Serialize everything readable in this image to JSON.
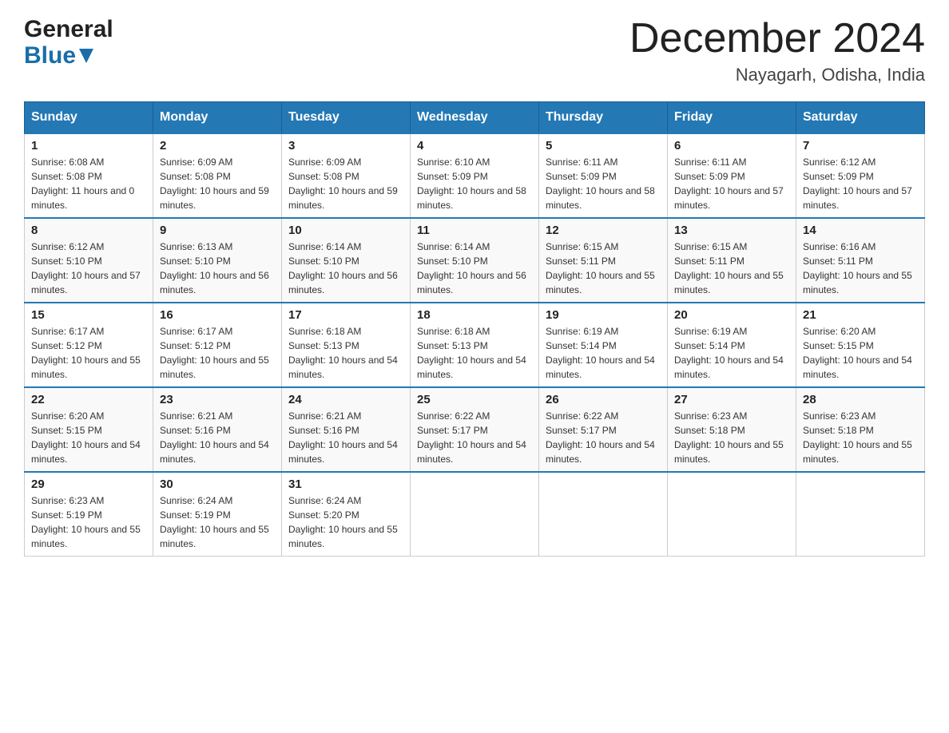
{
  "header": {
    "logo_general": "General",
    "logo_blue": "Blue",
    "month_title": "December 2024",
    "location": "Nayagarh, Odisha, India"
  },
  "calendar": {
    "columns": [
      "Sunday",
      "Monday",
      "Tuesday",
      "Wednesday",
      "Thursday",
      "Friday",
      "Saturday"
    ],
    "weeks": [
      [
        {
          "day": "1",
          "sunrise": "6:08 AM",
          "sunset": "5:08 PM",
          "daylight": "11 hours and 0 minutes."
        },
        {
          "day": "2",
          "sunrise": "6:09 AM",
          "sunset": "5:08 PM",
          "daylight": "10 hours and 59 minutes."
        },
        {
          "day": "3",
          "sunrise": "6:09 AM",
          "sunset": "5:08 PM",
          "daylight": "10 hours and 59 minutes."
        },
        {
          "day": "4",
          "sunrise": "6:10 AM",
          "sunset": "5:09 PM",
          "daylight": "10 hours and 58 minutes."
        },
        {
          "day": "5",
          "sunrise": "6:11 AM",
          "sunset": "5:09 PM",
          "daylight": "10 hours and 58 minutes."
        },
        {
          "day": "6",
          "sunrise": "6:11 AM",
          "sunset": "5:09 PM",
          "daylight": "10 hours and 57 minutes."
        },
        {
          "day": "7",
          "sunrise": "6:12 AM",
          "sunset": "5:09 PM",
          "daylight": "10 hours and 57 minutes."
        }
      ],
      [
        {
          "day": "8",
          "sunrise": "6:12 AM",
          "sunset": "5:10 PM",
          "daylight": "10 hours and 57 minutes."
        },
        {
          "day": "9",
          "sunrise": "6:13 AM",
          "sunset": "5:10 PM",
          "daylight": "10 hours and 56 minutes."
        },
        {
          "day": "10",
          "sunrise": "6:14 AM",
          "sunset": "5:10 PM",
          "daylight": "10 hours and 56 minutes."
        },
        {
          "day": "11",
          "sunrise": "6:14 AM",
          "sunset": "5:10 PM",
          "daylight": "10 hours and 56 minutes."
        },
        {
          "day": "12",
          "sunrise": "6:15 AM",
          "sunset": "5:11 PM",
          "daylight": "10 hours and 55 minutes."
        },
        {
          "day": "13",
          "sunrise": "6:15 AM",
          "sunset": "5:11 PM",
          "daylight": "10 hours and 55 minutes."
        },
        {
          "day": "14",
          "sunrise": "6:16 AM",
          "sunset": "5:11 PM",
          "daylight": "10 hours and 55 minutes."
        }
      ],
      [
        {
          "day": "15",
          "sunrise": "6:17 AM",
          "sunset": "5:12 PM",
          "daylight": "10 hours and 55 minutes."
        },
        {
          "day": "16",
          "sunrise": "6:17 AM",
          "sunset": "5:12 PM",
          "daylight": "10 hours and 55 minutes."
        },
        {
          "day": "17",
          "sunrise": "6:18 AM",
          "sunset": "5:13 PM",
          "daylight": "10 hours and 54 minutes."
        },
        {
          "day": "18",
          "sunrise": "6:18 AM",
          "sunset": "5:13 PM",
          "daylight": "10 hours and 54 minutes."
        },
        {
          "day": "19",
          "sunrise": "6:19 AM",
          "sunset": "5:14 PM",
          "daylight": "10 hours and 54 minutes."
        },
        {
          "day": "20",
          "sunrise": "6:19 AM",
          "sunset": "5:14 PM",
          "daylight": "10 hours and 54 minutes."
        },
        {
          "day": "21",
          "sunrise": "6:20 AM",
          "sunset": "5:15 PM",
          "daylight": "10 hours and 54 minutes."
        }
      ],
      [
        {
          "day": "22",
          "sunrise": "6:20 AM",
          "sunset": "5:15 PM",
          "daylight": "10 hours and 54 minutes."
        },
        {
          "day": "23",
          "sunrise": "6:21 AM",
          "sunset": "5:16 PM",
          "daylight": "10 hours and 54 minutes."
        },
        {
          "day": "24",
          "sunrise": "6:21 AM",
          "sunset": "5:16 PM",
          "daylight": "10 hours and 54 minutes."
        },
        {
          "day": "25",
          "sunrise": "6:22 AM",
          "sunset": "5:17 PM",
          "daylight": "10 hours and 54 minutes."
        },
        {
          "day": "26",
          "sunrise": "6:22 AM",
          "sunset": "5:17 PM",
          "daylight": "10 hours and 54 minutes."
        },
        {
          "day": "27",
          "sunrise": "6:23 AM",
          "sunset": "5:18 PM",
          "daylight": "10 hours and 55 minutes."
        },
        {
          "day": "28",
          "sunrise": "6:23 AM",
          "sunset": "5:18 PM",
          "daylight": "10 hours and 55 minutes."
        }
      ],
      [
        {
          "day": "29",
          "sunrise": "6:23 AM",
          "sunset": "5:19 PM",
          "daylight": "10 hours and 55 minutes."
        },
        {
          "day": "30",
          "sunrise": "6:24 AM",
          "sunset": "5:19 PM",
          "daylight": "10 hours and 55 minutes."
        },
        {
          "day": "31",
          "sunrise": "6:24 AM",
          "sunset": "5:20 PM",
          "daylight": "10 hours and 55 minutes."
        },
        null,
        null,
        null,
        null
      ]
    ]
  }
}
